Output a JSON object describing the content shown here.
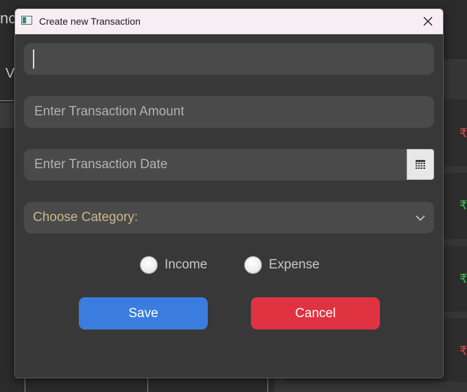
{
  "background": {
    "title_fragment": "nce",
    "left_header_fragment": "V",
    "rupee_symbol": "₹",
    "rupee_colors": [
      "#e04848",
      "#3cbf4a",
      "#3cbf4a",
      "#e04848"
    ]
  },
  "dialog": {
    "title": "Create new Transaction",
    "fields": {
      "name": {
        "value": "",
        "placeholder": ""
      },
      "amount": {
        "value": "",
        "placeholder": "Enter Transaction Amount"
      },
      "date": {
        "value": "",
        "placeholder": "Enter Transaction Date"
      },
      "category": {
        "selected": "Choose Category:"
      }
    },
    "type_options": [
      {
        "label": "Income",
        "checked": false
      },
      {
        "label": "Expense",
        "checked": false
      }
    ],
    "buttons": {
      "save": "Save",
      "cancel": "Cancel"
    },
    "colors": {
      "save": "#3a7ddf",
      "cancel": "#df3342",
      "category_text": "#c9b98a"
    }
  },
  "icons": {
    "window": "app-window-icon",
    "close": "close-icon",
    "calendar": "calendar-icon",
    "dropdown": "chevron-down-icon"
  }
}
